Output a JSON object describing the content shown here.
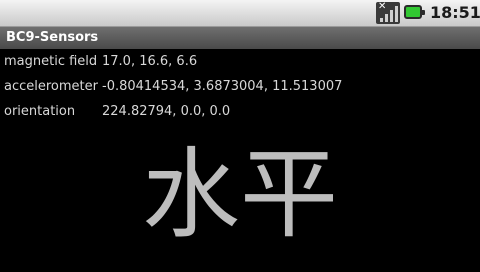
{
  "status_bar": {
    "signal_icon": "signal-no-data-icon",
    "battery_icon": "battery-icon",
    "battery_color": "#32c832",
    "time": "18:51"
  },
  "app": {
    "title": "BC9-Sensors"
  },
  "sensors": [
    {
      "label": "magnetic field",
      "value": "17.0, 16.6, 6.6"
    },
    {
      "label": "accelerometer",
      "value": "-0.80414534, 3.6873004, 11.513007"
    },
    {
      "label": "orientation",
      "value": "224.82794, 0.0, 0.0"
    }
  ],
  "level_status": "水平"
}
